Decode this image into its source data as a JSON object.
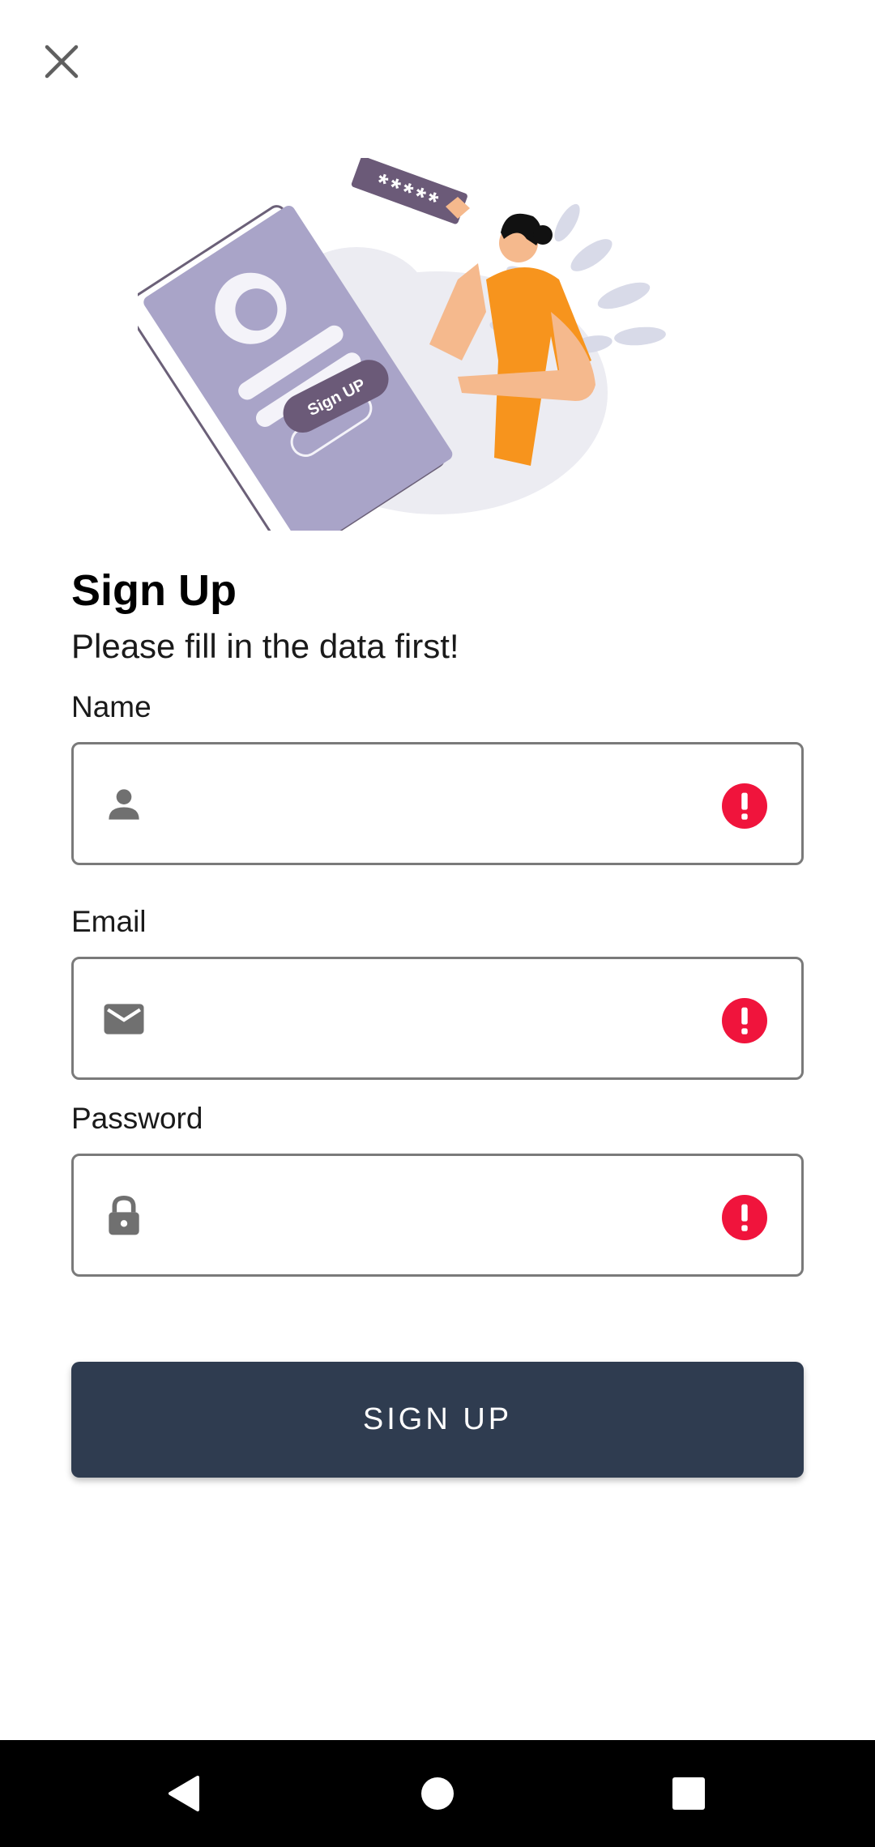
{
  "header": {
    "close_icon": "close-icon"
  },
  "illustration": {
    "button_text": "Sign UP",
    "password_mask": "*****"
  },
  "form": {
    "title": "Sign Up",
    "subtitle": "Please fill in the data first!",
    "fields": [
      {
        "label": "Name",
        "value": "",
        "icon": "person-icon",
        "error_icon": "error-icon"
      },
      {
        "label": "Email",
        "value": "",
        "icon": "mail-icon",
        "error_icon": "error-icon"
      },
      {
        "label": "Password",
        "value": "",
        "icon": "lock-icon",
        "error_icon": "error-icon"
      }
    ],
    "submit_label": "SIGN UP"
  },
  "colors": {
    "primary_button": "#2f3c50",
    "error": "#f0143c",
    "icon_gray": "#707070",
    "field_border": "#7a7a7a"
  },
  "system_nav": {
    "back_icon": "back-icon",
    "home_icon": "home-icon",
    "recents_icon": "recents-icon"
  }
}
